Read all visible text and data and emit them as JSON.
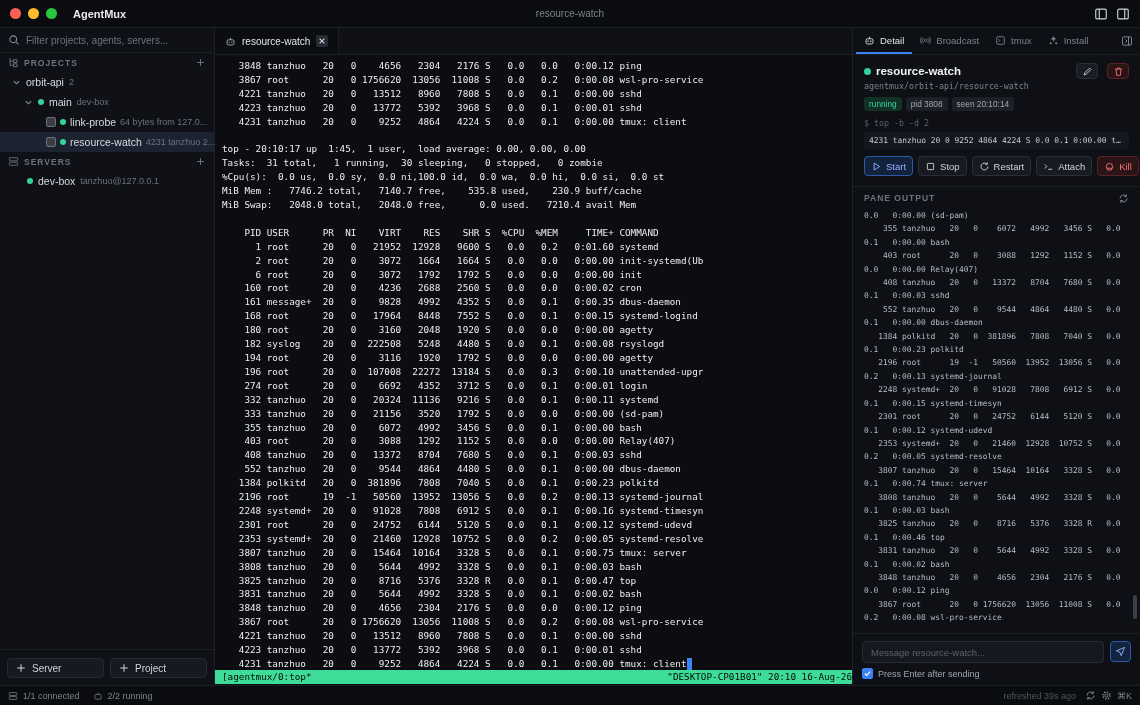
{
  "window": {
    "app_name": "AgentMux",
    "title": "resource-watch"
  },
  "sidebar": {
    "search_placeholder": "Filter projects, agents, servers...",
    "projects": {
      "title": "PROJECTS",
      "tree": [
        {
          "label": "orbit-api",
          "count": "2",
          "expanded": true,
          "children": [
            {
              "label": "main",
              "detail": "dev-box",
              "color": "#34d399",
              "expanded": true,
              "children": [
                {
                  "label": "link-probe",
                  "detail": "64 bytes from 127.0...",
                  "color": "#34d399",
                  "checked": false,
                  "selected": false
                },
                {
                  "label": "resource-watch",
                  "detail": "4231 tanzhuo 2...",
                  "color": "#34d399",
                  "checked": false,
                  "selected": true
                }
              ]
            }
          ]
        }
      ]
    },
    "servers": {
      "title": "SERVERS",
      "items": [
        {
          "label": "dev-box",
          "detail": "tanzhuo@127.0.0.1",
          "color": "#34d399"
        }
      ]
    },
    "buttons": [
      "Server",
      "Project"
    ]
  },
  "editor_tabs": [
    {
      "label": "resource-watch",
      "selected": true
    }
  ],
  "terminal": {
    "prev_rows": [
      [
        "3848",
        "tanzhuo",
        "20",
        "0",
        "4656",
        "2304",
        "2176",
        "S",
        "0.0",
        "0.0",
        "0:00.12",
        "ping"
      ],
      [
        "3867",
        "root",
        "20",
        "0",
        "1756620",
        "13056",
        "11008",
        "S",
        "0.0",
        "0.2",
        "0:00.08",
        "wsl-pro-service"
      ],
      [
        "4221",
        "tanzhuo",
        "20",
        "0",
        "13512",
        "8960",
        "7808",
        "S",
        "0.0",
        "0.1",
        "0:00.00",
        "sshd"
      ],
      [
        "4223",
        "tanzhuo",
        "20",
        "0",
        "13772",
        "5392",
        "3968",
        "S",
        "0.0",
        "0.1",
        "0:00.01",
        "sshd"
      ],
      [
        "4231",
        "tanzhuo",
        "20",
        "0",
        "9252",
        "4864",
        "4224",
        "S",
        "0.0",
        "0.1",
        "0:00.00",
        "tmux: client"
      ]
    ],
    "summary": [
      "top - 20:10:17 up  1:45,  1 user,  load average: 0.00, 0.00, 0.00",
      "Tasks:  31 total,   1 running,  30 sleeping,   0 stopped,   0 zombie",
      "%Cpu(s):  0.0 us,  0.0 sy,  0.0 ni,100.0 id,  0.0 wa,  0.0 hi,  0.0 si,  0.0 st",
      "MiB Mem :   7746.2 total,   7140.7 free,    535.8 used,    230.9 buff/cache",
      "MiB Swap:   2048.0 total,   2048.0 free,      0.0 used.   7210.4 avail Mem"
    ],
    "header": [
      "PID",
      "USER",
      "PR",
      "NI",
      "VIRT",
      "RES",
      "SHR",
      "S",
      "%CPU",
      "%MEM",
      "TIME+",
      "COMMAND"
    ],
    "rows": [
      [
        "1",
        "root",
        "20",
        "0",
        "21952",
        "12928",
        "9600",
        "S",
        "0.0",
        "0.2",
        "0:01.60",
        "systemd"
      ],
      [
        "2",
        "root",
        "20",
        "0",
        "3072",
        "1664",
        "1664",
        "S",
        "0.0",
        "0.0",
        "0:00.00",
        "init-systemd(Ub"
      ],
      [
        "6",
        "root",
        "20",
        "0",
        "3072",
        "1792",
        "1792",
        "S",
        "0.0",
        "0.0",
        "0:00.00",
        "init"
      ],
      [
        "160",
        "root",
        "20",
        "0",
        "4236",
        "2688",
        "2560",
        "S",
        "0.0",
        "0.0",
        "0:00.02",
        "cron"
      ],
      [
        "161",
        "message+",
        "20",
        "0",
        "9828",
        "4992",
        "4352",
        "S",
        "0.0",
        "0.1",
        "0:00.35",
        "dbus-daemon"
      ],
      [
        "168",
        "root",
        "20",
        "0",
        "17964",
        "8448",
        "7552",
        "S",
        "0.0",
        "0.1",
        "0:00.15",
        "systemd-logind"
      ],
      [
        "180",
        "root",
        "20",
        "0",
        "3160",
        "2048",
        "1920",
        "S",
        "0.0",
        "0.0",
        "0:00.00",
        "agetty"
      ],
      [
        "182",
        "syslog",
        "20",
        "0",
        "222508",
        "5248",
        "4480",
        "S",
        "0.0",
        "0.1",
        "0:00.08",
        "rsyslogd"
      ],
      [
        "194",
        "root",
        "20",
        "0",
        "3116",
        "1920",
        "1792",
        "S",
        "0.0",
        "0.0",
        "0:00.00",
        "agetty"
      ],
      [
        "196",
        "root",
        "20",
        "0",
        "107008",
        "22272",
        "13184",
        "S",
        "0.0",
        "0.3",
        "0:00.10",
        "unattended-upgr"
      ],
      [
        "274",
        "root",
        "20",
        "0",
        "6692",
        "4352",
        "3712",
        "S",
        "0.0",
        "0.1",
        "0:00.01",
        "login"
      ],
      [
        "332",
        "tanzhuo",
        "20",
        "0",
        "20324",
        "11136",
        "9216",
        "S",
        "0.0",
        "0.1",
        "0:00.11",
        "systemd"
      ],
      [
        "333",
        "tanzhuo",
        "20",
        "0",
        "21156",
        "3520",
        "1792",
        "S",
        "0.0",
        "0.0",
        "0:00.00",
        "(sd-pam)"
      ],
      [
        "355",
        "tanzhuo",
        "20",
        "0",
        "6072",
        "4992",
        "3456",
        "S",
        "0.0",
        "0.1",
        "0:00.00",
        "bash"
      ],
      [
        "403",
        "root",
        "20",
        "0",
        "3088",
        "1292",
        "1152",
        "S",
        "0.0",
        "0.0",
        "0:00.00",
        "Relay(407)"
      ],
      [
        "408",
        "tanzhuo",
        "20",
        "0",
        "13372",
        "8704",
        "7680",
        "S",
        "0.0",
        "0.1",
        "0:00.03",
        "sshd"
      ],
      [
        "552",
        "tanzhuo",
        "20",
        "0",
        "9544",
        "4864",
        "4480",
        "S",
        "0.0",
        "0.1",
        "0:00.00",
        "dbus-daemon"
      ],
      [
        "1384",
        "polkitd",
        "20",
        "0",
        "381896",
        "7808",
        "7040",
        "S",
        "0.0",
        "0.1",
        "0:00.23",
        "polkitd"
      ],
      [
        "2196",
        "root",
        "19",
        "-1",
        "50560",
        "13952",
        "13056",
        "S",
        "0.0",
        "0.2",
        "0:00.13",
        "systemd-journal"
      ],
      [
        "2248",
        "systemd+",
        "20",
        "0",
        "91028",
        "7808",
        "6912",
        "S",
        "0.0",
        "0.1",
        "0:00.16",
        "systemd-timesyn"
      ],
      [
        "2301",
        "root",
        "20",
        "0",
        "24752",
        "6144",
        "5120",
        "S",
        "0.0",
        "0.1",
        "0:00.12",
        "systemd-udevd"
      ],
      [
        "2353",
        "systemd+",
        "20",
        "0",
        "21460",
        "12928",
        "10752",
        "S",
        "0.0",
        "0.2",
        "0:00.05",
        "systemd-resolve"
      ],
      [
        "3807",
        "tanzhuo",
        "20",
        "0",
        "15464",
        "10164",
        "3328",
        "S",
        "0.0",
        "0.1",
        "0:00.75",
        "tmux: server"
      ],
      [
        "3808",
        "tanzhuo",
        "20",
        "0",
        "5644",
        "4992",
        "3328",
        "S",
        "0.0",
        "0.1",
        "0:00.03",
        "bash"
      ],
      [
        "3825",
        "tanzhuo",
        "20",
        "0",
        "8716",
        "5376",
        "3328",
        "R",
        "0.0",
        "0.1",
        "0:00.47",
        "top"
      ],
      [
        "3831",
        "tanzhuo",
        "20",
        "0",
        "5644",
        "4992",
        "3328",
        "S",
        "0.0",
        "0.1",
        "0:00.02",
        "bash"
      ],
      [
        "3848",
        "tanzhuo",
        "20",
        "0",
        "4656",
        "2304",
        "2176",
        "S",
        "0.0",
        "0.0",
        "0:00.12",
        "ping"
      ],
      [
        "3867",
        "root",
        "20",
        "0",
        "1756620",
        "13056",
        "11008",
        "S",
        "0.0",
        "0.2",
        "0:00.08",
        "wsl-pro-service"
      ],
      [
        "4221",
        "tanzhuo",
        "20",
        "0",
        "13512",
        "8960",
        "7808",
        "S",
        "0.0",
        "0.1",
        "0:00.00",
        "sshd"
      ],
      [
        "4223",
        "tanzhuo",
        "20",
        "0",
        "13772",
        "5392",
        "3968",
        "S",
        "0.0",
        "0.1",
        "0:00.01",
        "sshd"
      ],
      [
        "4231",
        "tanzhuo",
        "20",
        "0",
        "9252",
        "4864",
        "4224",
        "S",
        "0.0",
        "0.1",
        "0:00.00",
        "tmux: client"
      ]
    ],
    "status_left": "[agentmux/0:top*",
    "status_right": "\"DESKTOP-CP01B01\" 20:10 16-Aug-26"
  },
  "detail_panel": {
    "tabs": [
      {
        "label": "Detail",
        "kind": "robot",
        "selected": true
      },
      {
        "label": "Broadcast",
        "kind": "broadcast",
        "selected": false
      },
      {
        "label": "tmux",
        "kind": "terminal",
        "selected": false
      },
      {
        "label": "Install",
        "kind": "sparkle",
        "selected": false
      }
    ],
    "name": "resource-watch",
    "path": "agentmux/orbit-api/resource-watch",
    "badges": [
      {
        "label": "running",
        "kind": "status"
      },
      {
        "label": "pid 3808",
        "kind": "info"
      },
      {
        "label": "seen 20:10:14",
        "kind": "info"
      }
    ],
    "command": "$ top -b -d 2",
    "last_line": "4231 tanzhuo 20 0 9252 4864 4224 S 0.0 0.1 0:00.00 t…",
    "actions": [
      {
        "label": "Start",
        "kind": "start"
      },
      {
        "label": "Stop",
        "kind": "stop"
      },
      {
        "label": "Restart",
        "kind": "restart"
      },
      {
        "label": "Attach",
        "kind": "attach"
      },
      {
        "label": "Kill",
        "kind": "kill"
      }
    ],
    "pane_output": {
      "title": "PANE OUTPUT",
      "first_line": "0.0   0:00.00 (sd-pam)",
      "rows": [
        [
          "355",
          "tanzhuo",
          "20",
          "0",
          "6072",
          "4992",
          "3456",
          "S",
          "0.0",
          "0.1",
          "0:00.00",
          "bash"
        ],
        [
          "403",
          "root",
          "20",
          "0",
          "3088",
          "1292",
          "1152",
          "S",
          "0.0",
          "0.0",
          "0:00.00",
          "Relay(407)"
        ],
        [
          "408",
          "tanzhuo",
          "20",
          "0",
          "13372",
          "8704",
          "7680",
          "S",
          "0.0",
          "0.1",
          "0:00.03",
          "sshd"
        ],
        [
          "552",
          "tanzhuo",
          "20",
          "0",
          "9544",
          "4864",
          "4480",
          "S",
          "0.0",
          "0.1",
          "0:00.00",
          "dbus-daemon"
        ],
        [
          "1384",
          "polkitd",
          "20",
          "0",
          "381896",
          "7808",
          "7040",
          "S",
          "0.0",
          "0.1",
          "0:00.23",
          "polkitd"
        ],
        [
          "2196",
          "root",
          "19",
          "-1",
          "50560",
          "13952",
          "13056",
          "S",
          "0.0",
          "0.2",
          "0:00.13",
          "systemd-journal"
        ],
        [
          "2248",
          "systemd+",
          "20",
          "0",
          "91028",
          "7808",
          "6912",
          "S",
          "0.0",
          "0.1",
          "0:00.15",
          "systemd-timesyn"
        ],
        [
          "2301",
          "root",
          "20",
          "0",
          "24752",
          "6144",
          "5120",
          "S",
          "0.0",
          "0.1",
          "0:00.12",
          "systemd-udevd"
        ],
        [
          "2353",
          "systemd+",
          "20",
          "0",
          "21460",
          "12928",
          "10752",
          "S",
          "0.0",
          "0.2",
          "0:00.05",
          "systemd-resolve"
        ],
        [
          "3807",
          "tanzhuo",
          "20",
          "0",
          "15464",
          "10164",
          "3328",
          "S",
          "0.0",
          "0.1",
          "0:00.74",
          "tmux: server"
        ],
        [
          "3808",
          "tanzhuo",
          "20",
          "0",
          "5644",
          "4992",
          "3328",
          "S",
          "0.0",
          "0.1",
          "0:00.03",
          "bash"
        ],
        [
          "3825",
          "tanzhuo",
          "20",
          "0",
          "8716",
          "5376",
          "3328",
          "R",
          "0.0",
          "0.1",
          "0:00.46",
          "top"
        ],
        [
          "3831",
          "tanzhuo",
          "20",
          "0",
          "5644",
          "4992",
          "3328",
          "S",
          "0.0",
          "0.1",
          "0:00.02",
          "bash"
        ],
        [
          "3848",
          "tanzhuo",
          "20",
          "0",
          "4656",
          "2304",
          "2176",
          "S",
          "0.0",
          "0.0",
          "0:00.12",
          "ping"
        ],
        [
          "3867",
          "root",
          "20",
          "0",
          "1756620",
          "13056",
          "11008",
          "S",
          "0.0",
          "0.2",
          "0:00.08",
          "wsl-pro-service"
        ]
      ]
    },
    "message_placeholder": "Message resource-watch...",
    "enter_option": {
      "label": "Press Enter after sending",
      "checked": true
    }
  },
  "status_bar": {
    "connected": "1/1 connected",
    "running": "2/2 running",
    "refreshed": "refreshed 39s ago",
    "shortcut": "⌘K"
  }
}
